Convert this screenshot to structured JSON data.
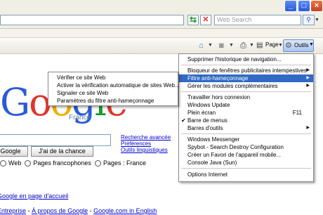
{
  "window_controls": {
    "minimize": "_",
    "maximize": "□",
    "close": "×"
  },
  "addressbar": {
    "search_placeholder": "Web Search"
  },
  "command_bar": {
    "home_icon": "home-icon",
    "feeds_icon": "feeds-icon",
    "print_icon": "print-icon",
    "page_label": "Page",
    "tools_label": "Outils",
    "tools_icon": "gear-icon"
  },
  "tools_menu": {
    "items": [
      "Supprimer l'historique de navigation...",
      "Bloqueur de fenêtres publicitaires intempestives",
      "Filtre anti-hameçonnage",
      "Gérer les modules complémentaires",
      "Travailler hors connexion",
      "Windows Update",
      "Plein écran",
      "Barre de menus",
      "Barres d'outils",
      "Windows Messenger",
      "Spybot - Search  Destroy Configuration",
      "Créer un Favori de l'appareil mobile...",
      "Console Java (Sun)",
      "Options Internet"
    ],
    "fullscreen_shortcut": "F11"
  },
  "phishing_submenu": {
    "items": [
      "Vérifier ce site Web",
      "Activer la vérification automatique de sites Web...",
      "Signaler ce site Web",
      "Paramètres du filtre anti-hameçonnage"
    ]
  },
  "google": {
    "logo_letters": [
      "G",
      "o",
      "o",
      "g",
      "l",
      "e"
    ],
    "country": "France",
    "search_links": [
      "Recherche avancée",
      "Préférences",
      "Outils linguistiques"
    ],
    "search_button": "Google",
    "lucky_button": "J'ai de la chance",
    "radio_options": [
      "Web",
      "Pages francophones",
      "Pages : France"
    ],
    "home_link": "Google en page d'accueil",
    "footer_links": [
      "Entreprise",
      "À propos de Google",
      "Google.com in English"
    ],
    "footer_separator": "-"
  }
}
